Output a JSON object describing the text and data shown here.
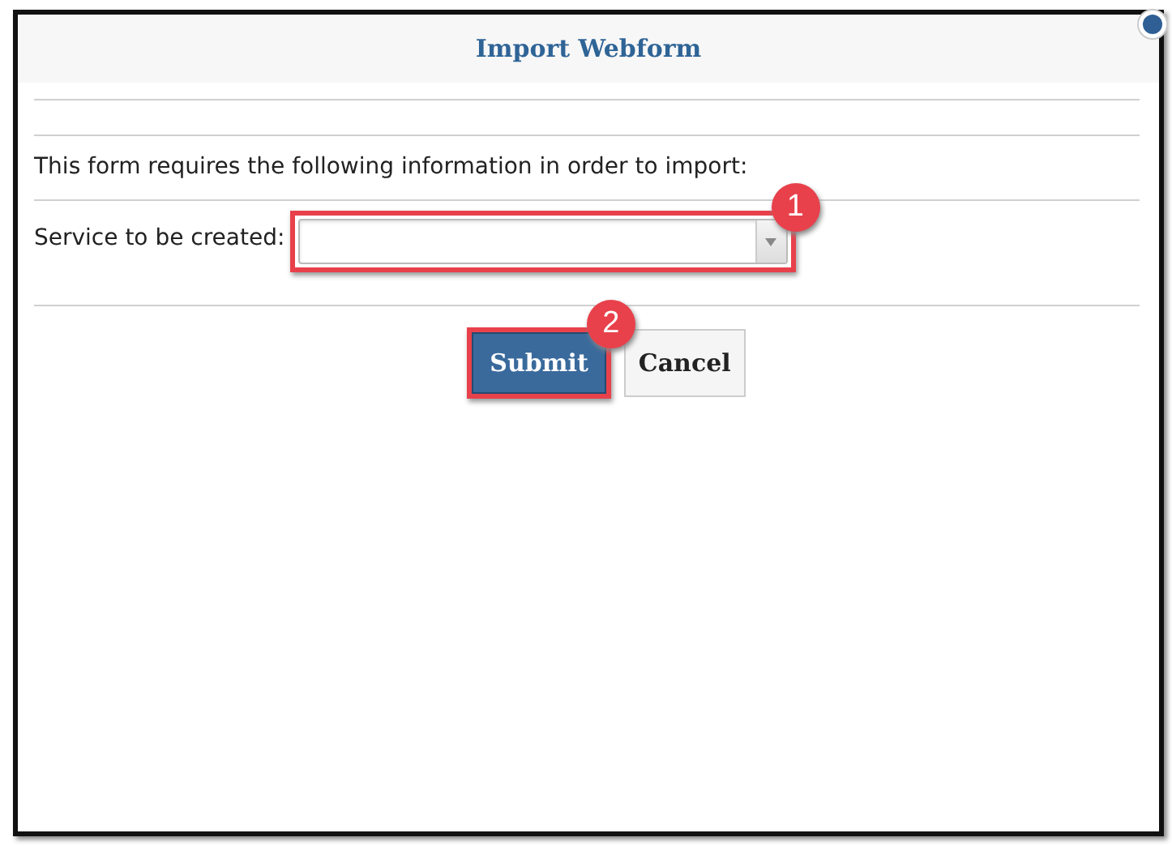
{
  "dialog": {
    "title": "Import Webform"
  },
  "intro": "This form requires the following information in order to import:",
  "field": {
    "label": "Service to be created:",
    "callout": "1"
  },
  "buttons": [
    {
      "label": "Submit",
      "kind": "primary",
      "callout": "2"
    },
    {
      "label": "Cancel",
      "kind": "secondary"
    }
  ]
}
